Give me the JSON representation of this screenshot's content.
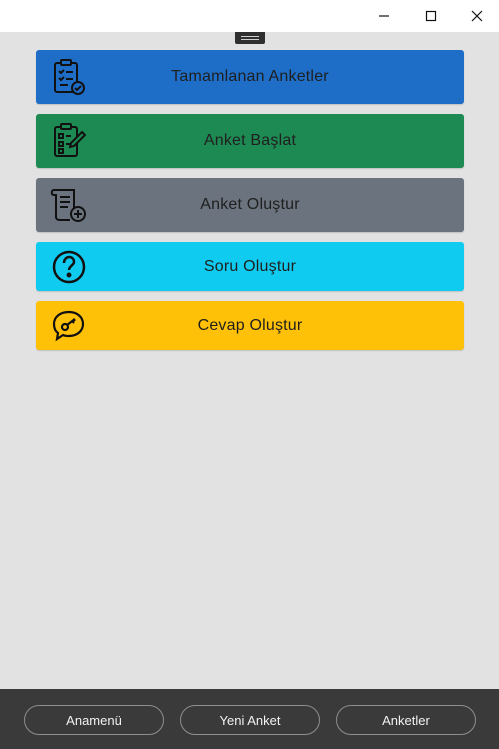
{
  "window": {
    "minimize_icon": "minimize-icon",
    "maximize_icon": "maximize-icon",
    "close_icon": "close-icon"
  },
  "menu": {
    "items": [
      {
        "label": "Tamamlanan Anketler",
        "icon": "clipboard-check-icon",
        "color": "#1e6ec8"
      },
      {
        "label": "Anket Başlat",
        "icon": "clipboard-edit-icon",
        "color": "#1e8a53"
      },
      {
        "label": "Anket Oluştur",
        "icon": "document-plus-icon",
        "color": "#6b747e"
      },
      {
        "label": "Soru Oluştur",
        "icon": "question-circle-icon",
        "color": "#10cbf0"
      },
      {
        "label": "Cevap Oluştur",
        "icon": "speech-key-icon",
        "color": "#ffc107"
      }
    ]
  },
  "bottom_nav": {
    "items": [
      {
        "label": "Anamenü"
      },
      {
        "label": "Yeni Anket"
      },
      {
        "label": "Anketler"
      }
    ]
  }
}
